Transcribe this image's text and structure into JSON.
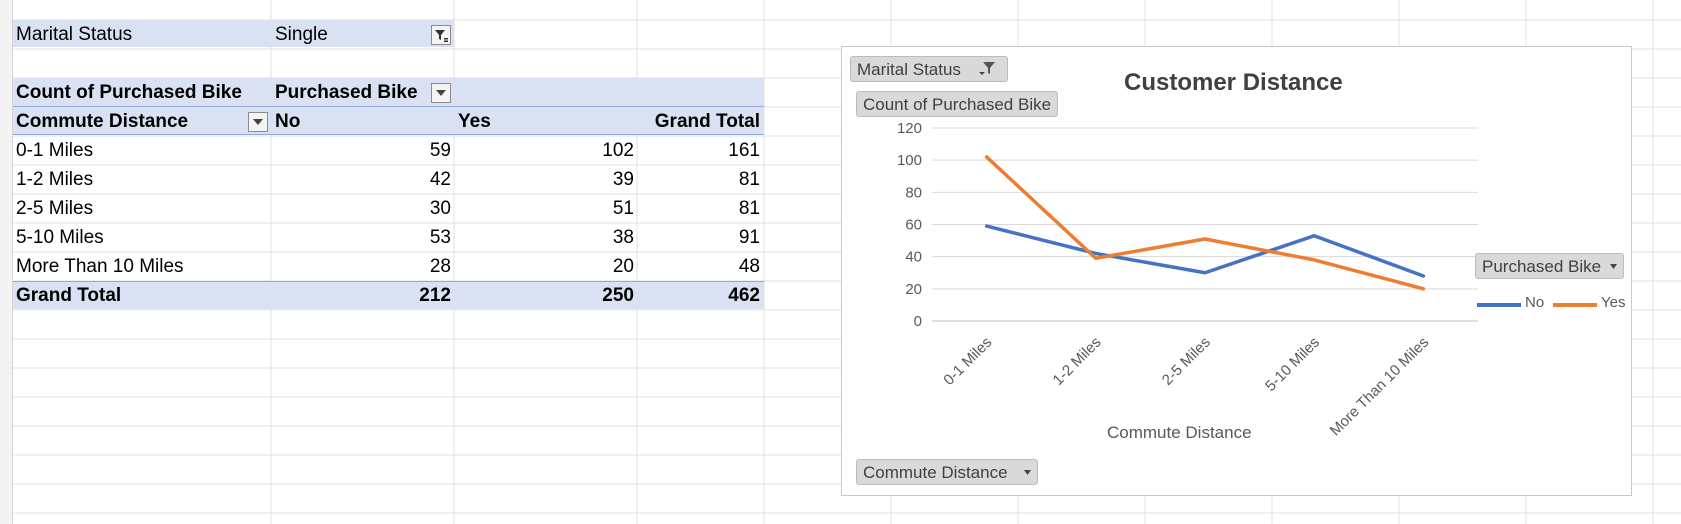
{
  "filter": {
    "label": "Marital Status",
    "value": "Single"
  },
  "pivot": {
    "value_field": "Count of Purchased Bike",
    "column_field": "Purchased Bike",
    "row_field": "Commute Distance",
    "columns": [
      "No",
      "Yes",
      "Grand Total"
    ],
    "rows": [
      {
        "label": "0-1 Miles",
        "no": "59",
        "yes": "102",
        "total": "161"
      },
      {
        "label": "1-2 Miles",
        "no": "42",
        "yes": "39",
        "total": "81"
      },
      {
        "label": "2-5 Miles",
        "no": "30",
        "yes": "51",
        "total": "81"
      },
      {
        "label": "5-10 Miles",
        "no": "53",
        "yes": "38",
        "total": "91"
      },
      {
        "label": "More Than 10 Miles",
        "no": "28",
        "yes": "20",
        "total": "48"
      }
    ],
    "grand_total": {
      "label": "Grand Total",
      "no": "212",
      "yes": "250",
      "total": "462"
    }
  },
  "chart_buttons": {
    "filter": "Marital Status",
    "values": "Count of Purchased Bike",
    "legend": "Purchased Bike",
    "axis": "Commute Distance"
  },
  "chart_data": {
    "type": "line",
    "title": "Customer Distance",
    "xlabel": "Commute Distance",
    "ylabel": "",
    "categories": [
      "0-1 Miles",
      "1-2 Miles",
      "2-5 Miles",
      "5-10 Miles",
      "More Than 10 Miles"
    ],
    "ylim": [
      0,
      120
    ],
    "yticks": [
      0,
      20,
      40,
      60,
      80,
      100,
      120
    ],
    "grid": true,
    "legend_position": "right",
    "series": [
      {
        "name": "No",
        "color": "#4472c4",
        "values": [
          59,
          42,
          30,
          53,
          28
        ]
      },
      {
        "name": "Yes",
        "color": "#ed7d31",
        "values": [
          102,
          39,
          51,
          38,
          20
        ]
      }
    ]
  }
}
